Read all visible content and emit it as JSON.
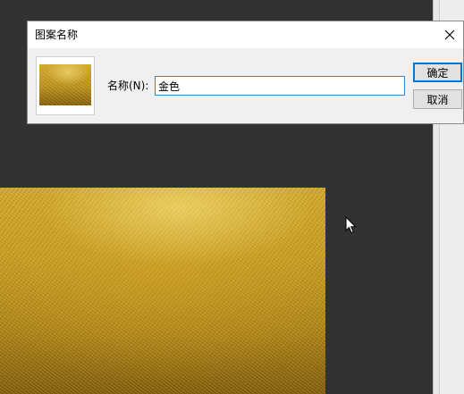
{
  "dialog": {
    "title": "图案名称",
    "name_label": "名称(N):",
    "name_value": "金色",
    "ok_label": "确定",
    "cancel_label": "取消"
  },
  "icons": {
    "close": "close-icon",
    "cursor": "mouse-pointer-icon",
    "thumbnail": "pattern-thumbnail"
  },
  "colors": {
    "workspace": "#323232",
    "dialog_bg": "#f0f0f0",
    "input_border": "#3a86c8",
    "default_button_border": "#0078d7",
    "gold": "#c39a22"
  }
}
